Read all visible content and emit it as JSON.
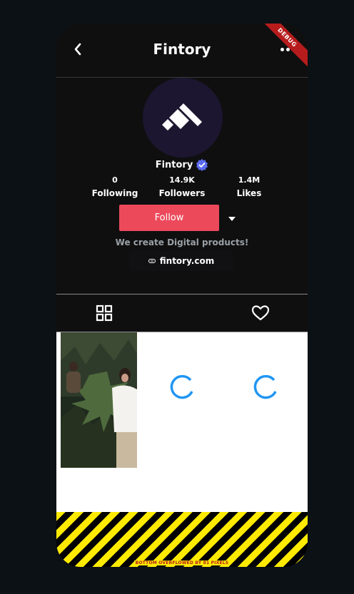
{
  "app": {
    "title": "Fintory",
    "debug_banner": "DEBUG"
  },
  "profile": {
    "name": "Fintory",
    "stats": [
      {
        "value": "0",
        "label": "Following"
      },
      {
        "value": "14.9K",
        "label": "Followers"
      },
      {
        "value": "1.4M",
        "label": "Likes"
      }
    ],
    "follow_label": "Follow",
    "bio": "We create Digital products!",
    "link": "fintory.com"
  },
  "overflow_warning": "BOTTOM OVERFLOWED BY 81 PIXELS",
  "colors": {
    "accent": "#ec4a5b",
    "verified": "#5b6cf0",
    "spinner": "#2196f3",
    "background": "#0f0f10"
  },
  "icons": [
    "back-icon",
    "more-icon",
    "verified-icon",
    "dropdown-arrow-icon",
    "link-icon",
    "grid-icon",
    "heart-icon",
    "loading-spinner"
  ]
}
